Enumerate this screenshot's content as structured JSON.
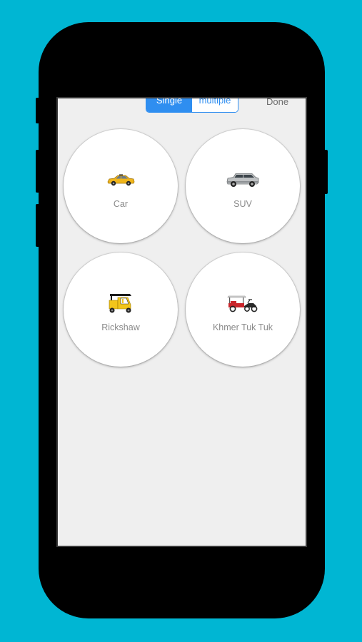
{
  "colors": {
    "background": "#00b6d3",
    "accent": "#2f8ef0",
    "screen": "#efefef"
  },
  "header": {
    "segment_single_label": "Single",
    "segment_multiple_label": "multiple",
    "done_label": "Done",
    "selected_segment": "Single"
  },
  "vehicles": [
    {
      "label": "Car",
      "icon": "car-icon"
    },
    {
      "label": "SUV",
      "icon": "suv-icon"
    },
    {
      "label": "Rickshaw",
      "icon": "rickshaw-icon"
    },
    {
      "label": "Khmer Tuk Tuk",
      "icon": "tuk-tuk-icon"
    }
  ]
}
